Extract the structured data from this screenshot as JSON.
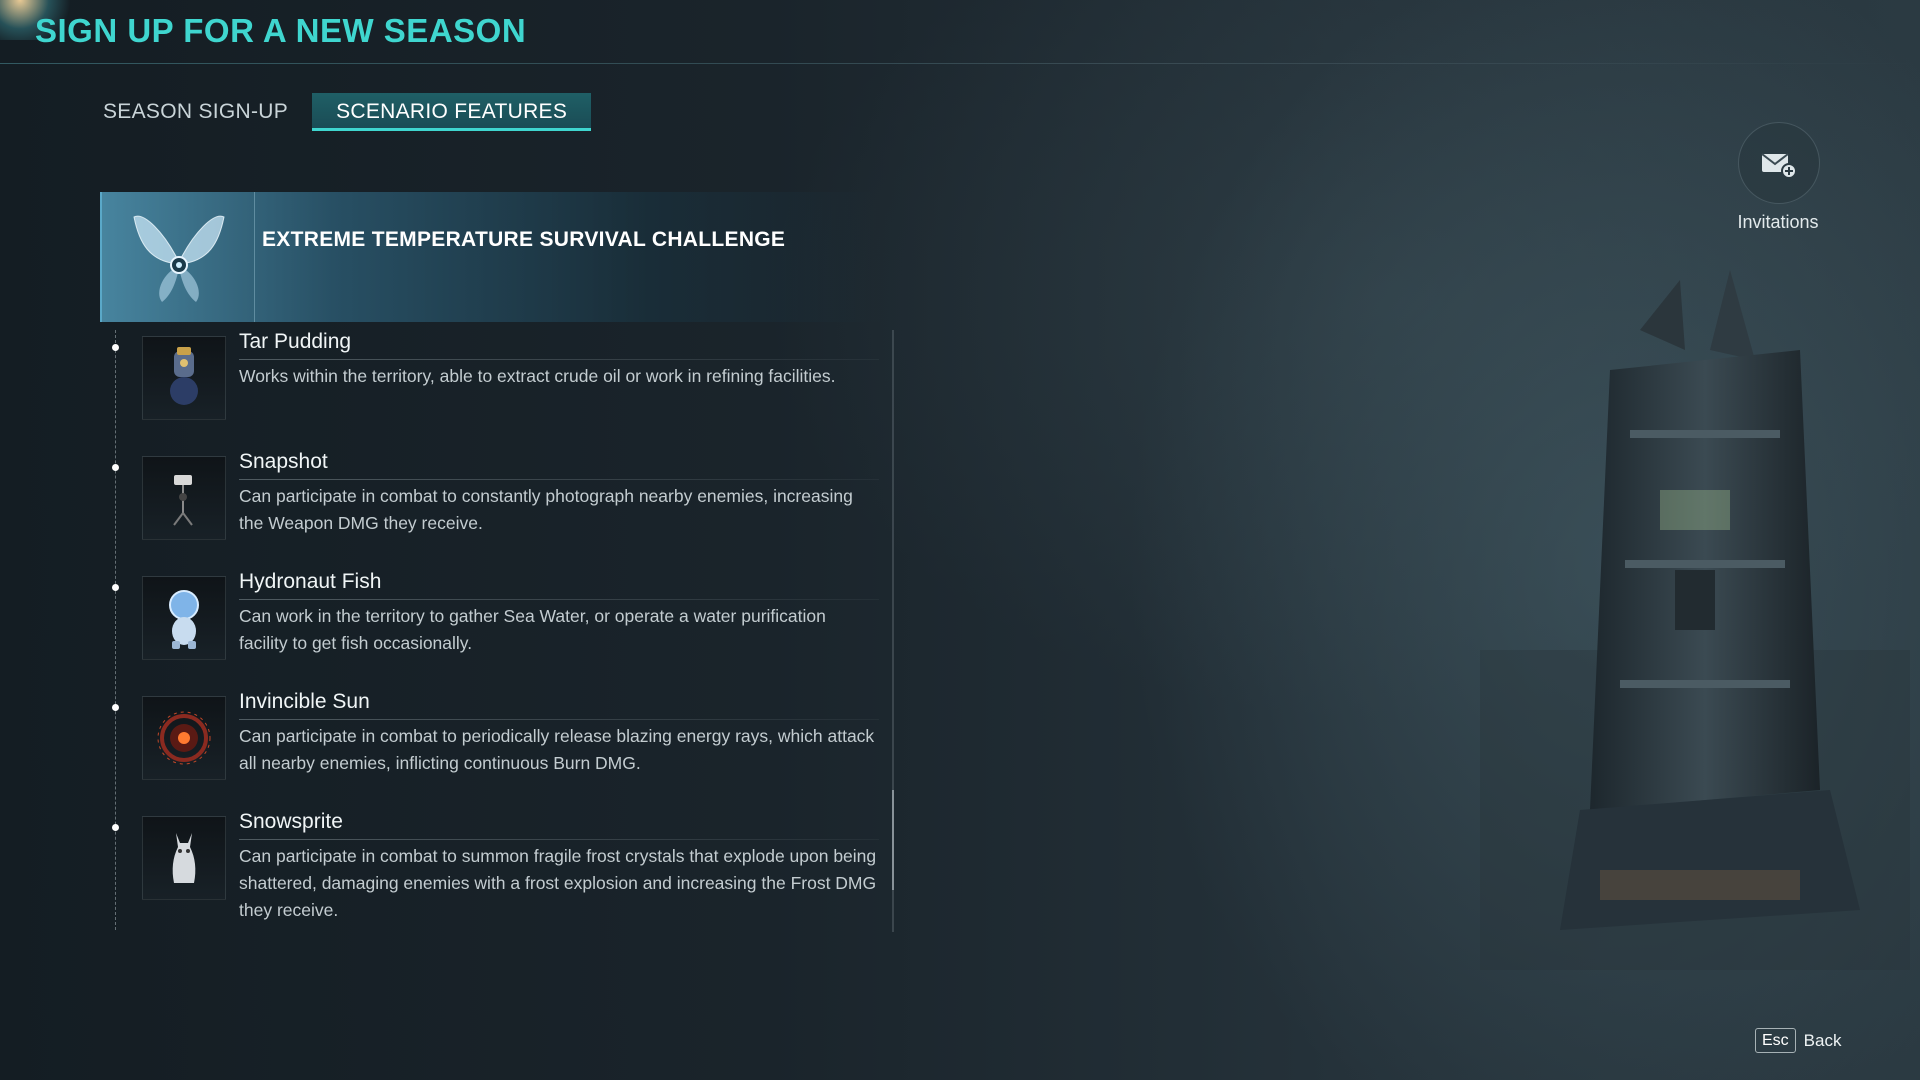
{
  "header": {
    "title": "SIGN UP FOR A NEW SEASON"
  },
  "tabs": [
    {
      "label": "SEASON SIGN-UP",
      "active": false
    },
    {
      "label": "SCENARIO FEATURES",
      "active": true
    }
  ],
  "scenario": {
    "title": "EXTREME TEMPERATURE SURVIVAL CHALLENGE",
    "emblem_icon": "butterfly-emblem-icon"
  },
  "features": [
    {
      "name": "Tar Pudding",
      "description": "Works within the territory, able to extract crude oil or work in refining facilities.",
      "icon": "tar-pudding-icon"
    },
    {
      "name": "Snapshot",
      "description": "Can participate in combat to constantly photograph nearby enemies, increasing the Weapon DMG they receive.",
      "icon": "snapshot-icon"
    },
    {
      "name": "Hydronaut Fish",
      "description": "Can work in the territory to gather Sea Water, or operate a water purification facility to get fish occasionally.",
      "icon": "hydronaut-fish-icon"
    },
    {
      "name": "Invincible Sun",
      "description": "Can participate in combat to periodically release blazing energy rays, which attack all nearby enemies, inflicting continuous Burn DMG.",
      "icon": "invincible-sun-icon"
    },
    {
      "name": "Snowsprite",
      "description": "Can participate in combat to summon fragile frost crystals that explode upon being shattered, damaging enemies with a frost explosion and increasing the Frost DMG they receive.",
      "icon": "snowsprite-icon"
    }
  ],
  "invitations": {
    "label": "Invitations",
    "icon": "mail-plus-icon"
  },
  "footer": {
    "key": "Esc",
    "label": "Back"
  },
  "colors": {
    "accent": "#3fd6cf",
    "tab_active_bg": "#1f5f66",
    "banner": "#4f96b4"
  }
}
